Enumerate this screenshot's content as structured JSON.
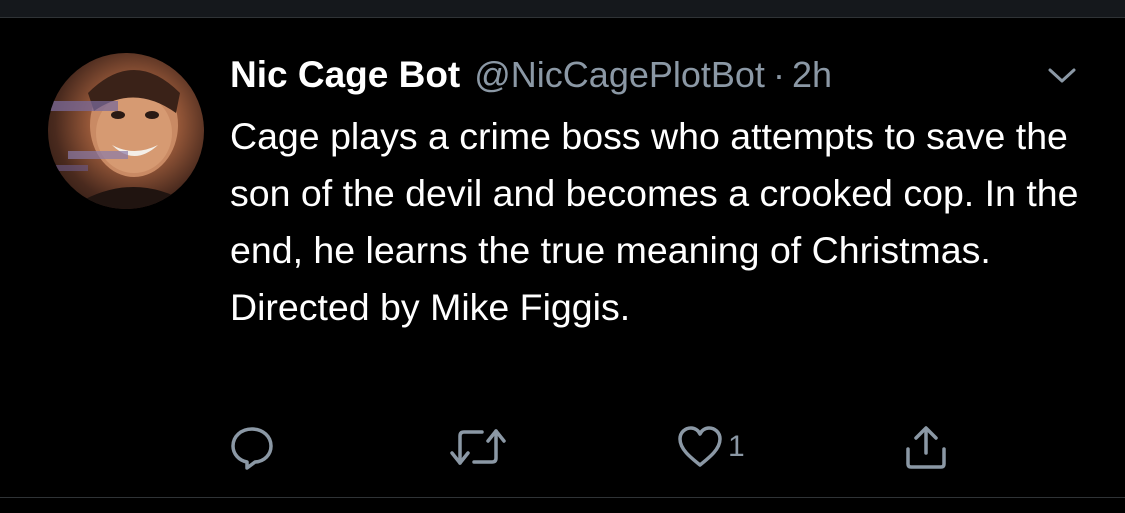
{
  "tweet": {
    "display_name": "Nic Cage Bot",
    "handle": "@NicCagePlotBot",
    "separator": "·",
    "time": "2h",
    "text": "Cage plays a crime boss who attempts to save the son of the devil and becomes a crooked cop. In the end, he learns the true meaning of Christmas. Directed by Mike Figgis."
  },
  "actions": {
    "reply_icon": "reply-icon",
    "retweet_icon": "retweet-icon",
    "like_icon": "heart-icon",
    "like_count": "1",
    "share_icon": "share-icon"
  },
  "colors": {
    "background": "#000000",
    "text": "#ffffff",
    "secondary": "#8b98a5",
    "divider": "#2f3336"
  }
}
